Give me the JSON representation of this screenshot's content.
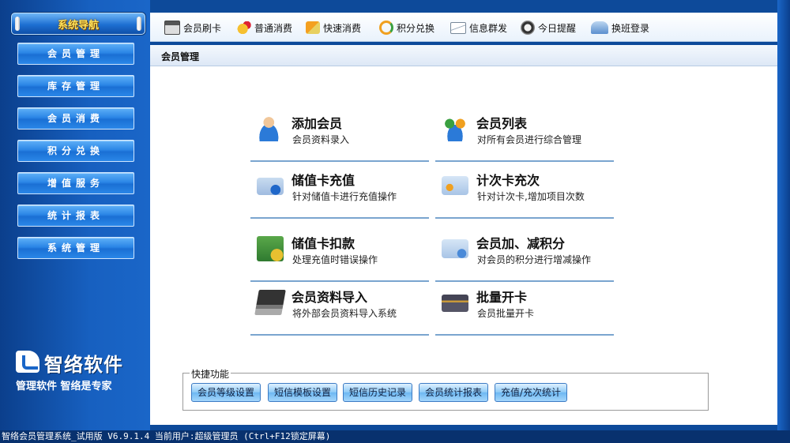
{
  "sidebar": {
    "title": "系统导航",
    "items": [
      {
        "label": "会员管理"
      },
      {
        "label": "库存管理"
      },
      {
        "label": "会员消费"
      },
      {
        "label": "积分兑换"
      },
      {
        "label": "增值服务"
      },
      {
        "label": "统计报表"
      },
      {
        "label": "系统管理"
      }
    ],
    "logo": {
      "name": "智络软件",
      "slogan": "管理软件 智络是专家"
    }
  },
  "toolbar": {
    "items": [
      {
        "label": "会员刷卡",
        "icon": "card-reader-icon"
      },
      {
        "label": "普通消费",
        "icon": "coins-person-icon"
      },
      {
        "label": "快速消费",
        "icon": "fast-money-icon"
      },
      {
        "label": "积分兑换",
        "icon": "exchange-arrows-icon"
      },
      {
        "label": "信息群发",
        "icon": "envelope-icon"
      },
      {
        "label": "今日提醒",
        "icon": "clock-icon"
      },
      {
        "label": "换班登录",
        "icon": "shift-login-icon"
      }
    ]
  },
  "content": {
    "title": "会员管理",
    "functions": [
      {
        "title": "添加会员",
        "desc": "会员资料录入",
        "icon": "add-member-icon"
      },
      {
        "title": "会员列表",
        "desc": "对所有会员进行综合管理",
        "icon": "member-list-icon"
      },
      {
        "title": "储值卡充值",
        "desc": "针对储值卡进行充值操作",
        "icon": "card-recharge-icon"
      },
      {
        "title": "计次卡充次",
        "desc": "针对计次卡,增加项目次数",
        "icon": "count-card-icon"
      },
      {
        "title": "储值卡扣款",
        "desc": "处理充值时错误操作",
        "icon": "card-deduct-icon"
      },
      {
        "title": "会员加、减积分",
        "desc": "对会员的积分进行增减操作",
        "icon": "points-adjust-icon"
      },
      {
        "title": "会员资料导入",
        "desc": "将外部会员资料导入系统",
        "icon": "import-laptop-icon"
      },
      {
        "title": "批量开卡",
        "desc": "会员批量开卡",
        "icon": "batch-card-icon"
      }
    ],
    "shortcuts": {
      "legend": "快捷功能",
      "buttons": [
        "会员等级设置",
        "短信模板设置",
        "短信历史记录",
        "会员统计报表",
        "充值/充次统计"
      ]
    }
  },
  "status_bar": {
    "text": "智络会员管理系统_试用版 V6.9.1.4 当前用户:超级管理员 (Ctrl+F12锁定屏幕)"
  },
  "colors": {
    "sidebar_bg": "#1760c0",
    "nav_button": "#2b86e6",
    "nav_title": "#ffe35a",
    "status_bar_bg": "#08316e",
    "divider": "#7aa5cf"
  }
}
